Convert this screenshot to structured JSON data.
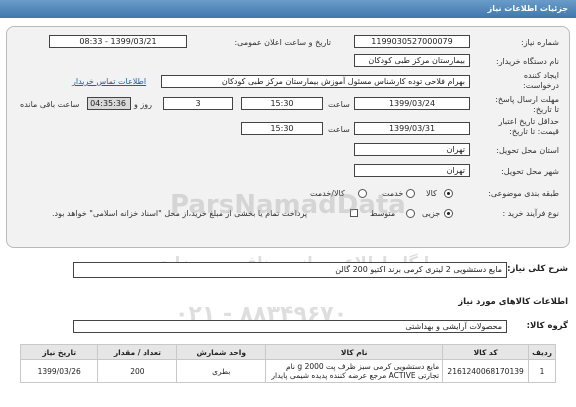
{
  "header": {
    "title": "جزئیات اطلاعات نیاز"
  },
  "form": {
    "need_number_label": "شماره نیاز:",
    "need_number": "1199030527000079",
    "announce_label": "تاریخ و ساعت اعلان عمومی:",
    "announce_value": "1399/03/21 - 08:33",
    "buyer_label": "نام دستگاه خریدار:",
    "buyer_value": "بیمارستان مرکز طبی کودکان",
    "creator_label": "ایجاد کننده درخواست:",
    "creator_value": "بهرام فلاحی توده کارشناس مسئول آموزش بیمارستان مرکز طبی کودکان",
    "contact_link": "اطلاعات تماس خریدار",
    "deadline_label": "مهلت ارسال پاسخ: تا تاریخ:",
    "deadline_date": "1399/03/24",
    "time_label": "ساعت",
    "deadline_time": "15:30",
    "days_value": "3",
    "days_label": "روز و",
    "remaining_time": "04:35:36",
    "remaining_label": "ساعت باقی مانده",
    "validity_label": "حداقل تاریخ اعتبار قیمت: تا تاریخ:",
    "validity_date": "1399/03/31",
    "validity_time_label": "ساعت",
    "validity_time": "15:30",
    "province_label": "استان محل تحویل:",
    "province_value": "تهران",
    "city_label": "شهر محل تحویل:",
    "city_value": "تهران",
    "category_label": "طبقه بندی موضوعی:",
    "category_options": [
      "کالا",
      "خدمت",
      "کالا/خدمت"
    ],
    "process_label": "نوع فرآیند خرید :",
    "process_options": [
      "جزیی",
      "متوسط"
    ],
    "payment_note": "پرداخت تمام یا بخشی از مبلغ خرید،از محل \"اسناد خزانه اسلامی\" خواهد بود."
  },
  "summary": {
    "label": "شرح کلی نیاز:",
    "value": "مایع دستشویی 2 لیتری کرمی برند اکتیو 200 گالن"
  },
  "goods_info": {
    "title": "اطلاعات کالاهای مورد نیاز"
  },
  "goods_group": {
    "label": "گروه کالا:",
    "value": "محصولات آرایشی و بهداشتی"
  },
  "table": {
    "headers": [
      "ردیف",
      "کد کالا",
      "نام کالا",
      "واحد شمارش",
      "تعداد / مقدار",
      "تاریخ نیاز"
    ],
    "rows": [
      {
        "row": "1",
        "code": "2161240068170139",
        "name": "مایع دستشویی کرمی سبز ظرف پت 2000 g نام تجارتی ACTIVE مرجع عرضه کننده پدیده شیمی پایدار",
        "unit": "بطری",
        "qty": "200",
        "date": "1399/03/26"
      }
    ]
  },
  "watermark": {
    "brand": "ParsNamadData",
    "line1": "پایگاه اطلاع رسانی مناقصه و مزایده",
    "phone": "۰۲۱ - ۸۸۳۴۹۶۷۰"
  }
}
